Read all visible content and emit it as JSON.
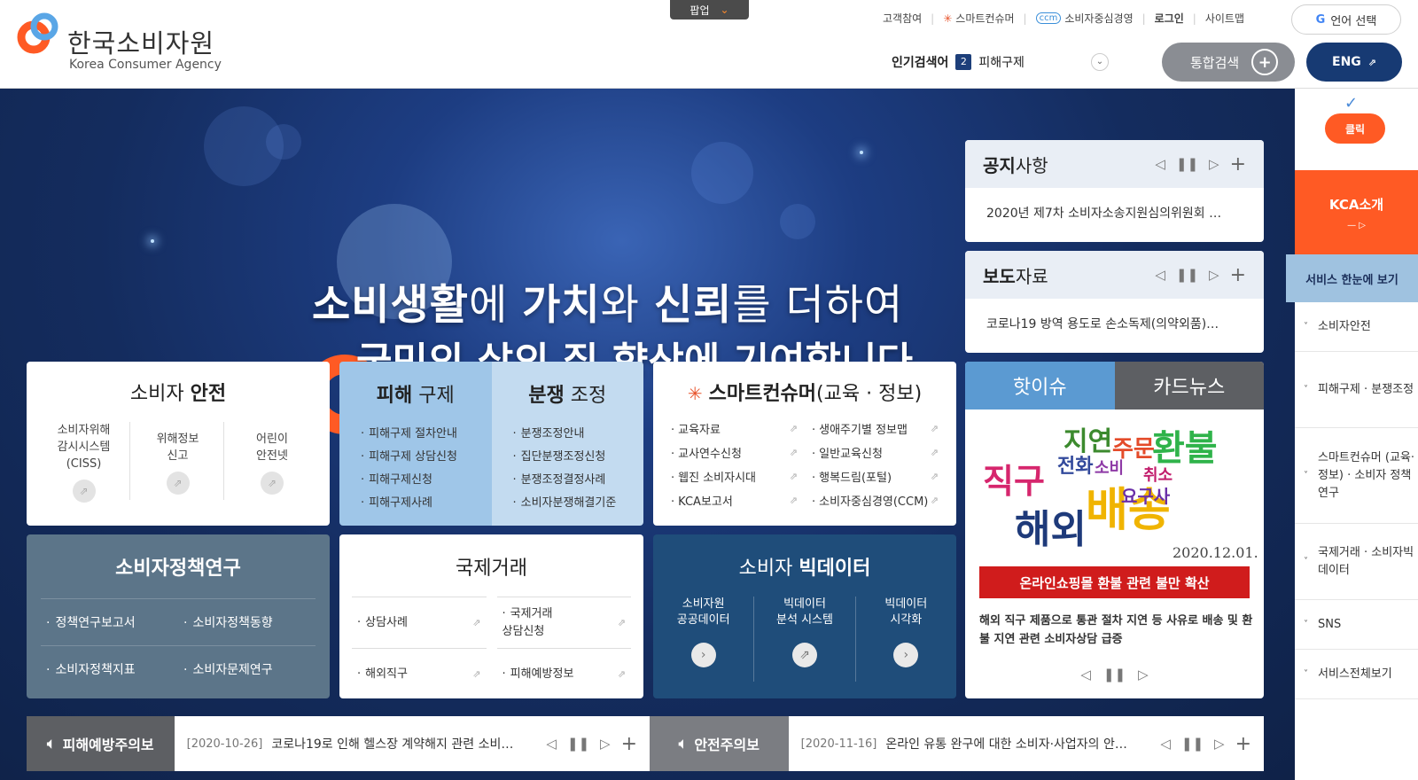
{
  "header": {
    "logo_ko": "한국소비자원",
    "logo_en": "Korea Consumer Agency",
    "popup_label": "팝업",
    "util_links": [
      "고객참여",
      "스마트컨슈머",
      "소비자중심경영",
      "로그인",
      "사이트맵"
    ],
    "lang_label": "언어 선택",
    "popular_label": "인기검색어",
    "popular_rank": "2",
    "popular_term": "피해구제",
    "search_label": "통합검색",
    "eng_label": "ENG"
  },
  "hero": {
    "line1_a": "소비생활",
    "line1_b": "에 ",
    "line1_c": "가치",
    "line1_d": "와 ",
    "line1_e": "신뢰",
    "line1_f": "를 더하여",
    "line2": "국민의 삶의 질 향상에 기여합니다."
  },
  "notice": {
    "title_b": "공지",
    "title_r": "사항",
    "text": "2020년 제7차 소비자소송지원심의위원회 …"
  },
  "press": {
    "title_b": "보도",
    "title_r": "자료",
    "text": "코로나19 방역 용도로 손소독제(의약외품)…"
  },
  "safety": {
    "title_r": "소비자 ",
    "title_b": "안전",
    "cols": [
      {
        "l1": "소비자위해",
        "l2": "감시시스템",
        "l3": "(CISS)"
      },
      {
        "l1": "위해정보",
        "l2": "신고",
        "l3": ""
      },
      {
        "l1": "어린이",
        "l2": "안전넷",
        "l3": ""
      }
    ]
  },
  "relief": {
    "title_b": "피해",
    "title_r": " 구제",
    "items": [
      "피해구제 절차안내",
      "피해구제 상담신청",
      "피해구제신청",
      "피해구제사례"
    ]
  },
  "dispute": {
    "title_b": "분쟁",
    "title_r": " 조정",
    "items": [
      "분쟁조정안내",
      "집단분쟁조정신청",
      "분쟁조정결정사례",
      "소비자분쟁해결기준"
    ]
  },
  "smart": {
    "title_b": "스마트컨슈머",
    "title_r": "(교육 · 정보)",
    "items": [
      "교육자료",
      "생애주기별 정보맵",
      "교사연수신청",
      "일반교육신청",
      "웹진 소비자시대",
      "행복드림(포털)",
      "KCA보고서",
      "소비자중심경영(CCM)"
    ]
  },
  "policy": {
    "title": "소비자정책연구",
    "items": [
      "정책연구보고서",
      "소비자정책동향",
      "소비자정책지표",
      "소비자문제연구"
    ]
  },
  "intl": {
    "title": "국제거래",
    "items": [
      "상담사례",
      "국제거래 상담신청",
      "해외직구",
      "피해예방정보"
    ]
  },
  "bigdata": {
    "title_r": "소비자 ",
    "title_b": "빅데이터",
    "cols": [
      {
        "l1": "소비자원",
        "l2": "공공데이터"
      },
      {
        "l1": "빅데이터",
        "l2": "분석 시스템"
      },
      {
        "l1": "빅데이터",
        "l2": "시각화"
      }
    ]
  },
  "issue": {
    "tab1": "핫이슈",
    "tab2": "카드뉴스",
    "cloud_words": [
      "직구",
      "해외",
      "배송",
      "환불",
      "지연",
      "주문",
      "전화",
      "소비",
      "취소",
      "요구사"
    ],
    "date": "2020.12.01.",
    "banner": "온라인쇼핑몰 환불 관련 불만 확산",
    "text": "해외 직구 제품으로 통관 절차 지연 등 사유로 배송 및 환불 지연 관련 소비자상담 급증"
  },
  "tickers": [
    {
      "label": "피해예방주의보",
      "date": "[2020-10-26]",
      "text": "코로나19로 인해 헬스장 계약해지 관련 소비…"
    },
    {
      "label": "안전주의보",
      "date": "[2020-11-16]",
      "text": "온라인 유통 완구에 대한 소비자·사업자의 안…"
    }
  ],
  "side": {
    "click": "클릭",
    "kca": "KCA소개",
    "svc": "서비스 한눈에 보기",
    "items": [
      "소비자안전",
      "피해구제 · 분쟁조정",
      "스마트컨슈머 (교육·정보) · 소비자 정책연구",
      "국제거래 · 소비자빅데이터",
      "SNS",
      "서비스전체보기"
    ]
  },
  "colors": {
    "orange": "#ff5a24",
    "navy": "#173a73",
    "policy": "#5c7589",
    "bigdata": "#1f4d7a",
    "issueTab": "#5b9ad2"
  }
}
